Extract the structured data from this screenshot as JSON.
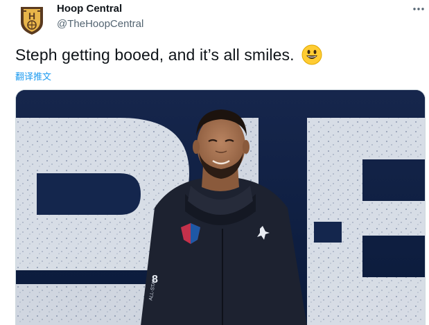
{
  "tweet": {
    "author": {
      "name": "Hoop Central",
      "handle": "@TheHoopCentral",
      "avatar_icon": "hoop-central-logo"
    },
    "more_icon": "more-horizontal-icon",
    "text": "Steph getting booed, and it’s all smiles.",
    "emoji": "grinning-face-emoji",
    "translate_label": "翻译推文",
    "media": {
      "type": "video-still",
      "background_letters": "BE",
      "jacket_number": "8",
      "jacket_text": "ALL-STAR"
    }
  },
  "colors": {
    "link": "#1d9bf0",
    "secondary_text": "#536471",
    "primary_text": "#0f1419",
    "avatar_brown": "#5a3a1f",
    "avatar_gold": "#e8b54a"
  }
}
